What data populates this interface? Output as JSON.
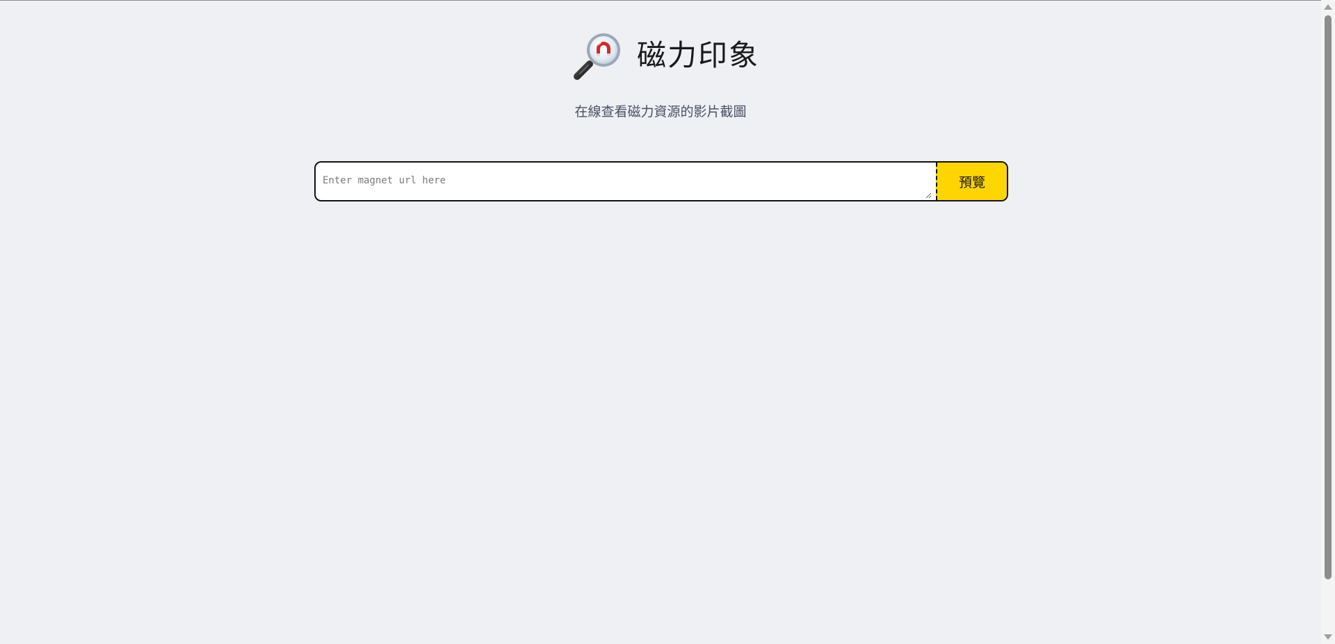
{
  "header": {
    "logo_icon": "magnet-magnifier-icon",
    "title": "磁力印象",
    "subtitle": "在線查看磁力資源的影片截圖"
  },
  "search": {
    "placeholder": "Enter magnet url here",
    "value": "",
    "button_label": "預覽"
  },
  "colors": {
    "background": "#eef0f4",
    "button": "#ffd500",
    "border": "#111111",
    "subtitle": "#4a4f63"
  }
}
